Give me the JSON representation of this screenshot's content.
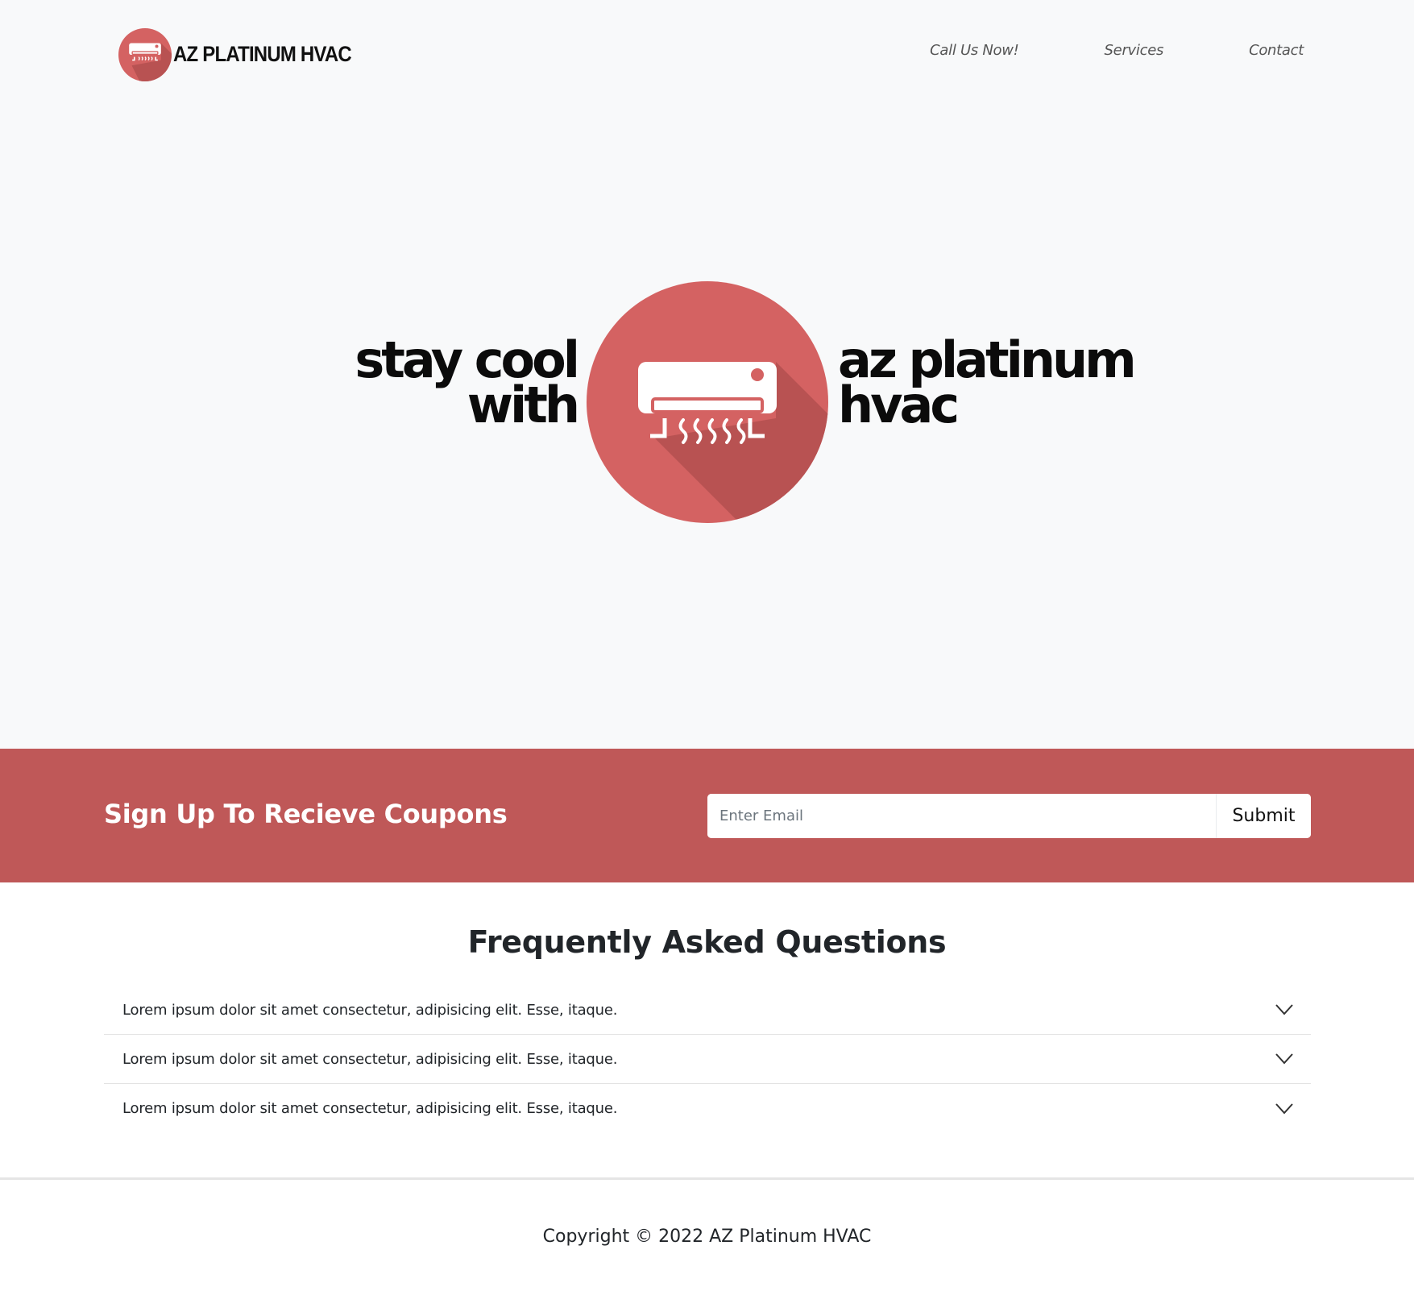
{
  "brand": {
    "name": "AZ PLATINUM HVAC",
    "logo_icon": "air-conditioner-icon",
    "logo_color": "#d46262"
  },
  "nav": {
    "items": [
      "Call Us Now!",
      "Services",
      "Contact"
    ]
  },
  "hero": {
    "left_line1": "stay cool",
    "left_line2": "with",
    "right_line1": "az platinum",
    "right_line2": "hvac",
    "logo_icon": "air-conditioner-icon",
    "circle_color": "#d46262",
    "shadow_color": "#b85252"
  },
  "coupon": {
    "title": "Sign Up To Recieve Coupons",
    "email_placeholder": "Enter Email",
    "email_value": "",
    "submit_label": "Submit",
    "band_color": "#bf5858"
  },
  "faq": {
    "title": "Frequently Asked Questions",
    "items": [
      {
        "question": "Lorem ipsum dolor sit amet consectetur, adipisicing elit. Esse, itaque.",
        "icon": "chevron-down-icon"
      },
      {
        "question": "Lorem ipsum dolor sit amet consectetur, adipisicing elit. Esse, itaque.",
        "icon": "chevron-down-icon"
      },
      {
        "question": "Lorem ipsum dolor sit amet consectetur, adipisicing elit. Esse, itaque.",
        "icon": "chevron-down-icon"
      }
    ]
  },
  "footer": {
    "copyright": "Copyright © 2022 AZ Platinum HVAC"
  }
}
